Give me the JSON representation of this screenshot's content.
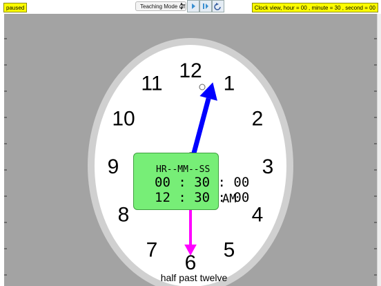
{
  "toolbar": {
    "mode_select_value": "Teaching Mode off",
    "play_label": "play",
    "step_label": "step",
    "reset_label": "reset"
  },
  "status": {
    "left": "paused",
    "right": "Clock view, hour = 00 , minute = 30 , second = 00"
  },
  "clock": {
    "numerals": [
      "12",
      "1",
      "2",
      "3",
      "4",
      "5",
      "6",
      "7",
      "8",
      "9",
      "10",
      "11"
    ],
    "hour": 0,
    "minute": 30,
    "second": 0,
    "hour_hand_color": "#0000ff",
    "minute_hand_color": "#ff00ff",
    "second_hand_color": "#8a8a8a"
  },
  "digital": {
    "header": "HR--MM--SS",
    "time24": "00 : 30 : 00",
    "time12": "12 : 30 : 00",
    "ampm": "AM"
  },
  "caption": "half past twelve"
}
